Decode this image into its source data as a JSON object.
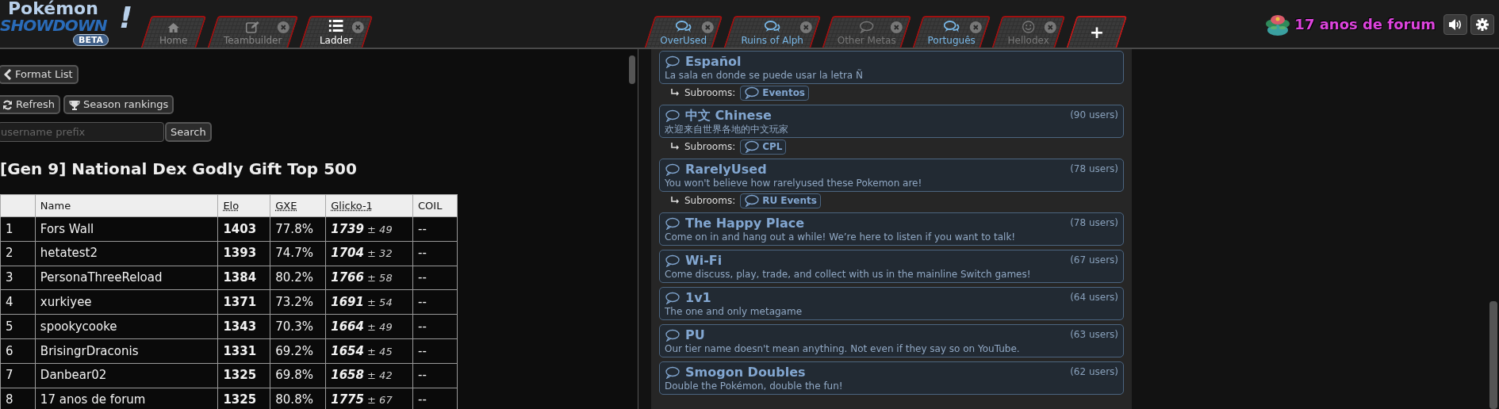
{
  "logo": {
    "line1": "Pokémon",
    "line2": "SHOWDOWN",
    "mark": "!",
    "badge": "BETA"
  },
  "main_tabs": [
    {
      "label": "Home",
      "kind": "home",
      "selected": false,
      "closable": false
    },
    {
      "label": "Teambuilder",
      "kind": "edit",
      "selected": false,
      "closable": true
    },
    {
      "label": "Ladder",
      "kind": "list",
      "selected": true,
      "closable": true
    }
  ],
  "room_tabs": [
    {
      "label": "OverUsed",
      "kind": "chats",
      "highlighted": true
    },
    {
      "label": "Ruins of Alph",
      "kind": "chats",
      "highlighted": true
    },
    {
      "label": "Other Metas",
      "kind": "chat",
      "highlighted": false
    },
    {
      "label": "Português",
      "kind": "chats",
      "highlighted": true
    },
    {
      "label": "Hellodex",
      "kind": "smile",
      "highlighted": false
    }
  ],
  "new_tab": "+",
  "user": {
    "name": "17 anos de forum"
  },
  "ladder": {
    "back_button": "Format List",
    "refresh_button": "Refresh",
    "season_button": "Season rankings",
    "search_placeholder": "username prefix",
    "search_button": "Search",
    "title": "[Gen 9] National Dex Godly Gift Top 500",
    "columns": [
      "",
      "Name",
      "Elo",
      "GXE",
      "Glicko-1",
      "COIL"
    ],
    "rows": [
      {
        "rank": "1",
        "name": "Fors Wall",
        "elo": "1403",
        "gxe": "77.8%",
        "glicko": "1739",
        "deviation": "± 49",
        "coil": "--"
      },
      {
        "rank": "2",
        "name": "hetatest2",
        "elo": "1393",
        "gxe": "74.7%",
        "glicko": "1704",
        "deviation": "± 32",
        "coil": "--"
      },
      {
        "rank": "3",
        "name": "PersonaThreeReload",
        "elo": "1384",
        "gxe": "80.2%",
        "glicko": "1766",
        "deviation": "± 58",
        "coil": "--"
      },
      {
        "rank": "4",
        "name": "xurkiyee",
        "elo": "1371",
        "gxe": "73.2%",
        "glicko": "1691",
        "deviation": "± 54",
        "coil": "--"
      },
      {
        "rank": "5",
        "name": "spookycooke",
        "elo": "1343",
        "gxe": "70.3%",
        "glicko": "1664",
        "deviation": "± 49",
        "coil": "--"
      },
      {
        "rank": "6",
        "name": "BrisingrDraconis",
        "elo": "1331",
        "gxe": "69.2%",
        "glicko": "1654",
        "deviation": "± 45",
        "coil": "--"
      },
      {
        "rank": "7",
        "name": "Danbear02",
        "elo": "1325",
        "gxe": "69.8%",
        "glicko": "1658",
        "deviation": "± 42",
        "coil": "--"
      },
      {
        "rank": "8",
        "name": "17 anos de forum",
        "elo": "1325",
        "gxe": "80.8%",
        "glicko": "1775",
        "deviation": "± 67",
        "coil": "--"
      }
    ]
  },
  "rooms": [
    {
      "title": "Español",
      "description": "La sala en donde se puede usar la letra Ñ",
      "subrooms_label": "Subrooms:",
      "subrooms": [
        "Eventos"
      ]
    },
    {
      "title": "中文 Chinese",
      "users": "(90 users)",
      "description": "欢迎来自世界各地的中文玩家",
      "subrooms_label": "Subrooms:",
      "subrooms": [
        "CPL"
      ]
    },
    {
      "title": "RarelyUsed",
      "users": "(78 users)",
      "description": "You won't believe how rarelyused these Pokemon are!",
      "subrooms_label": "Subrooms:",
      "subrooms": [
        "RU Events"
      ]
    },
    {
      "title": "The Happy Place",
      "users": "(78 users)",
      "description": "Come on in and hang out a while! We’re here to listen if you want to talk!"
    },
    {
      "title": "Wi-Fi",
      "users": "(67 users)",
      "description": "Come discuss, play, trade, and collect with us in the mainline Switch games!"
    },
    {
      "title": "1v1",
      "users": "(64 users)",
      "description": "The one and only metagame"
    },
    {
      "title": "PU",
      "users": "(63 users)",
      "description": "Our tier name doesn't mean anything. Not even if they say so on YouTube."
    },
    {
      "title": "Smogon Doubles",
      "users": "(62 users)",
      "description": "Double the Pokémon, double the fun!"
    }
  ]
}
